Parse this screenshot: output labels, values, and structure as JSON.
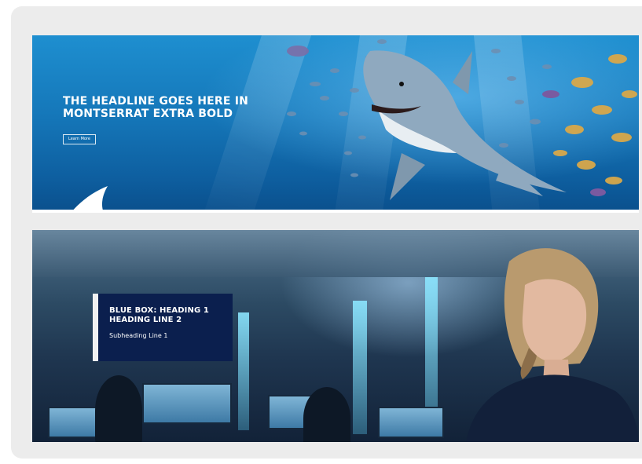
{
  "banner_top": {
    "headline_line1": "THE HEADLINE GOES HERE IN",
    "headline_line2": "MONTSERRAT EXTRA BOLD",
    "button_label": "Learn More"
  },
  "banner_bottom": {
    "heading_line1": "BLUE BOX: HEADING 1",
    "heading_line2": "HEADING LINE 2",
    "subheading": "Subheading Line 1"
  },
  "colors": {
    "card_background": "#ececec",
    "ocean_blue": "#1577b9",
    "blue_box": "#0b1f4e",
    "box_accent": "#f1f1f1"
  }
}
